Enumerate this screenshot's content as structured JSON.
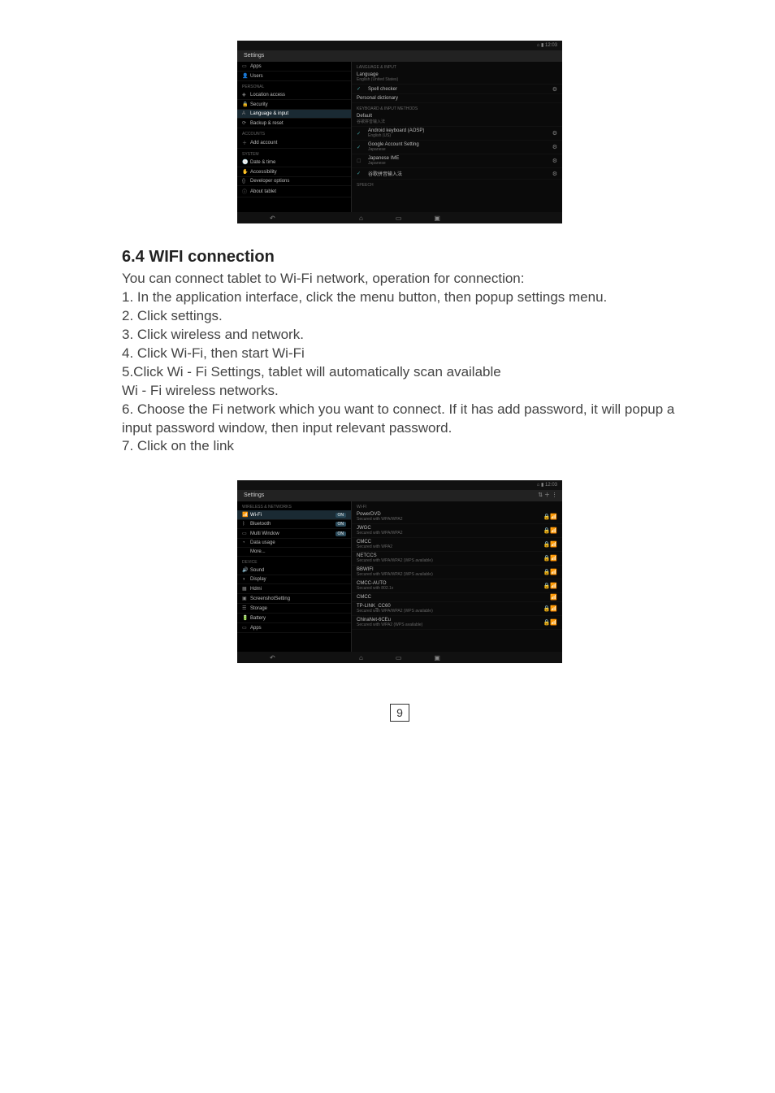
{
  "screenshot1": {
    "statusbar": {
      "right": "⌂   ▮ 12:03"
    },
    "title": "Settings",
    "left": {
      "items": [
        {
          "icon": "▭",
          "label": "Apps"
        },
        {
          "icon": "👤",
          "label": "Users"
        },
        {
          "header": true,
          "label": "PERSONAL"
        },
        {
          "icon": "◈",
          "label": "Location access"
        },
        {
          "icon": "🔒",
          "label": "Security"
        },
        {
          "icon": "A",
          "label": "Language & input",
          "selected": true
        },
        {
          "icon": "⟳",
          "label": "Backup & reset"
        },
        {
          "header": true,
          "label": "ACCOUNTS"
        },
        {
          "icon": "＋",
          "label": "Add account"
        },
        {
          "header": true,
          "label": "SYSTEM"
        },
        {
          "icon": "🕓",
          "label": "Date & time"
        },
        {
          "icon": "✋",
          "label": "Accessibility"
        },
        {
          "icon": "{}",
          "label": "Developer options"
        },
        {
          "icon": "ⓘ",
          "label": "About tablet"
        }
      ]
    },
    "right": {
      "header1": "LANGUAGE & INPUT",
      "items": [
        {
          "title": "Language",
          "sub": "English (United States)"
        },
        {
          "checked": true,
          "title": "Spell checker",
          "right": "⚙"
        },
        {
          "title": "Personal dictionary"
        },
        {
          "header": true,
          "label": "KEYBOARD & INPUT METHODS"
        },
        {
          "title": "Default",
          "sub": "谷歌拼音输入法"
        },
        {
          "checked": true,
          "title": "Android keyboard (AOSP)",
          "sub": "English (US)",
          "right": "⚙"
        },
        {
          "checked": true,
          "title": "Google Account Setting",
          "sub": "Japanese",
          "right": "⚙"
        },
        {
          "checked": false,
          "title": "Japanese IME",
          "sub": "Japanese",
          "right": "⚙"
        },
        {
          "checked": true,
          "title": "谷歌拼音输入法",
          "right": "⚙"
        },
        {
          "header": true,
          "label": "SPEECH"
        }
      ]
    },
    "navbar": {
      "back": "↶",
      "home": "⌂",
      "recent": "▭",
      "screenshot": "▣"
    }
  },
  "section_heading": "6.4  WIFI connection",
  "body_lines": [
    "You can connect tablet to Wi-Fi network, operation for connection:",
    "1. In the application  interface, click the menu button, then popup settings menu.",
    "2. Click settings.",
    "3. Click wireless and network.",
    "4. Click Wi-Fi, then start Wi-Fi",
    "5.Click Wi - Fi Settings, tablet will automatically scan available",
    "Wi - Fi wireless networks.",
    "6. Choose the Fi network which you want to connect. If it has add password, it will popup a",
    "input password window, then input relevant password.",
    "7. Click on the link"
  ],
  "screenshot2": {
    "statusbar": {
      "right": "⌂   ▮ 12:03"
    },
    "title": "Settings",
    "title_right": "⇅   ＋   ⋮",
    "left": {
      "items": [
        {
          "header": true,
          "label": "WIRELESS & NETWORKS"
        },
        {
          "icon": "📶",
          "label": "Wi-Fi",
          "toggle": "ON",
          "selected": true
        },
        {
          "icon": "ᛒ",
          "label": "Bluetooth",
          "toggle": "ON"
        },
        {
          "icon": "▭",
          "label": "Multi Window",
          "toggle": "ON"
        },
        {
          "icon": "◔",
          "label": "Data usage"
        },
        {
          "icon": "",
          "label": "More..."
        },
        {
          "header": true,
          "label": "DEVICE"
        },
        {
          "icon": "🔊",
          "label": "Sound"
        },
        {
          "icon": "◑",
          "label": "Display"
        },
        {
          "icon": "▦",
          "label": "Hdmi"
        },
        {
          "icon": "▣",
          "label": "ScreenshotSetting"
        },
        {
          "icon": "☰",
          "label": "Storage"
        },
        {
          "icon": "🔋",
          "label": "Battery"
        },
        {
          "icon": "▭",
          "label": "Apps"
        }
      ]
    },
    "right": {
      "header1": "Wi-Fi",
      "items": [
        {
          "title": "PowerDVD",
          "sub": "Secured with WPA/WPA2",
          "signal": "🔒📶"
        },
        {
          "title": "JWGC",
          "sub": "Secured with WPA/WPA2",
          "signal": "🔒📶"
        },
        {
          "title": "CMCC",
          "sub": "Secured with WPA2",
          "signal": "🔒📶"
        },
        {
          "title": "NETCCS",
          "sub": "Secured with WPA/WPA2 (WPS available)",
          "signal": "🔒📶"
        },
        {
          "title": "BBWIFI",
          "sub": "Secured with WPA/WPA2 (WPS available)",
          "signal": "🔒📶"
        },
        {
          "title": "CMCC-AUTO",
          "sub": "Secured with 802.1x",
          "signal": "🔒📶"
        },
        {
          "title": "CMCC",
          "sub": "",
          "signal": "📶"
        },
        {
          "title": "TP-LINK_CC60",
          "sub": "Secured with WPA/WPA2 (WPS available)",
          "signal": "🔒📶"
        },
        {
          "title": "ChinaNet-6CEu",
          "sub": "Secured with WPA2 (WPS available)",
          "signal": "🔒📶"
        }
      ]
    },
    "navbar": {
      "back": "↶",
      "home": "⌂",
      "recent": "▭",
      "screenshot": "▣"
    }
  },
  "page_number": "9"
}
